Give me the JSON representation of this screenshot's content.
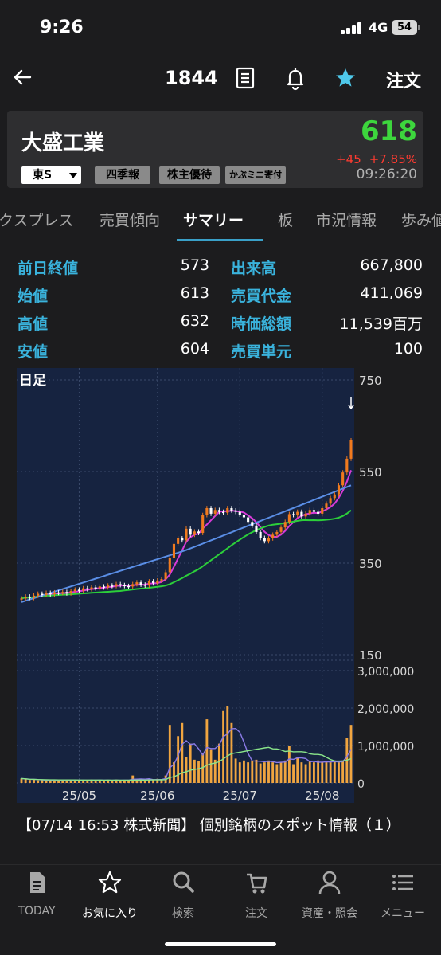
{
  "status_bar": {
    "time": "9:26",
    "network": "4G",
    "battery": "54"
  },
  "header": {
    "code": "1844",
    "order_label": "注文"
  },
  "quote": {
    "name": "大盛工業",
    "price": "618",
    "change": "+45",
    "change_pct": "+7.85%",
    "time": "09:26:20",
    "market": "東S",
    "tags": [
      "四季報",
      "株主優待",
      "かぶミニ寄付"
    ],
    "colors": {
      "up": "#3dd63d",
      "change": "#ff3b30"
    }
  },
  "tabs": [
    {
      "label": "クスプレス"
    },
    {
      "label": "売買傾向"
    },
    {
      "label": "サマリー",
      "active": true
    },
    {
      "label": "板"
    },
    {
      "label": "市況情報"
    },
    {
      "label": "歩み値"
    }
  ],
  "summary": {
    "left": [
      {
        "label": "前日終値",
        "value": "573"
      },
      {
        "label": "始値",
        "value": "613"
      },
      {
        "label": "高値",
        "value": "632"
      },
      {
        "label": "安値",
        "value": "604"
      }
    ],
    "right": [
      {
        "label": "出来高",
        "value": "667,800"
      },
      {
        "label": "売買代金",
        "value": "411,069"
      },
      {
        "label": "時価総額",
        "value": "11,539百万"
      },
      {
        "label": "売買単元",
        "value": "100"
      }
    ]
  },
  "chart_data": {
    "type": "candlestick",
    "period_label": "日足",
    "price_axis": {
      "ticks": [
        "750",
        "550",
        "350",
        "150"
      ],
      "range": [
        150,
        750
      ]
    },
    "volume_axis": {
      "ticks": [
        "3,000,000",
        "2,000,000",
        "1,000,000",
        "0"
      ],
      "range": [
        0,
        3000000
      ]
    },
    "x_labels": [
      "25/05",
      "25/06",
      "25/07",
      "25/08"
    ],
    "colors": {
      "up": "#f07a1e",
      "down": "#ffffff",
      "ma_short": "#d83ad8",
      "ma_mid": "#2ccf3a",
      "ma_long": "#5a8ee6",
      "volume": "#f0a540",
      "bg": "#162340"
    },
    "close": [
      273,
      277,
      274,
      279,
      283,
      281,
      285,
      282,
      286,
      285,
      287,
      284,
      289,
      292,
      290,
      295,
      293,
      297,
      295,
      299,
      297,
      301,
      300,
      304,
      302,
      300,
      299,
      304,
      308,
      303,
      301,
      310,
      306,
      312,
      315,
      330,
      362,
      392,
      404,
      400,
      425,
      412,
      419,
      416,
      455,
      470,
      458,
      466,
      462,
      460,
      470,
      465,
      462,
      456,
      450,
      440,
      432,
      418,
      405,
      398,
      404,
      412,
      418,
      428,
      440,
      457,
      455,
      462,
      452,
      458,
      466,
      462,
      458,
      470,
      480,
      492,
      500,
      520,
      548,
      578,
      618
    ],
    "volume": [
      0.12,
      0.1,
      0.08,
      0.09,
      0.07,
      0.08,
      0.06,
      0.07,
      0.08,
      0.06,
      0.07,
      0.09,
      0.08,
      0.07,
      0.06,
      0.08,
      0.07,
      0.09,
      0.08,
      0.07,
      0.06,
      0.08,
      0.07,
      0.09,
      0.06,
      0.08,
      0.07,
      0.2,
      0.1,
      0.08,
      0.06,
      0.12,
      0.09,
      0.11,
      0.08,
      0.2,
      1.55,
      0.55,
      1.25,
      1.6,
      0.7,
      1.05,
      0.62,
      0.58,
      0.8,
      1.7,
      0.9,
      0.62,
      1.05,
      1.92,
      2.05,
      1.6,
      0.65,
      0.55,
      0.6,
      0.55,
      0.6,
      0.62,
      0.52,
      0.55,
      0.6,
      0.55,
      0.5,
      0.55,
      0.6,
      1.0,
      0.5,
      0.7,
      0.55,
      0.5,
      0.58,
      0.55,
      0.6,
      0.55,
      0.55,
      0.55,
      0.6,
      0.55,
      0.6,
      1.2,
      1.55
    ]
  },
  "news": "【07/14 16:53 株式新聞】 個別銘柄のスポット情報（１）",
  "nav": [
    {
      "label": "TODAY",
      "icon": "today-icon"
    },
    {
      "label": "お気に入り",
      "icon": "star-icon",
      "active": true
    },
    {
      "label": "検索",
      "icon": "search-icon"
    },
    {
      "label": "注文",
      "icon": "cart-icon"
    },
    {
      "label": "資産・照会",
      "icon": "person-icon"
    },
    {
      "label": "メニュー",
      "icon": "menu-icon"
    }
  ]
}
